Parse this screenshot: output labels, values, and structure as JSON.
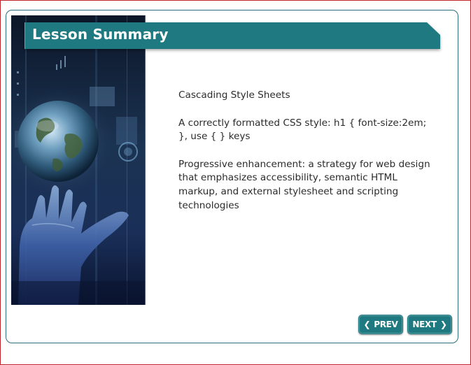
{
  "slide": {
    "title": "Lesson Summary",
    "paragraphs": [
      "Cascading Style Sheets",
      "A correctly formatted CSS style: h1 { font-size:2em; }, use { } keys",
      "Progressive enhancement: a strategy for web design that emphasizes accessibility, semantic HTML markup, and external stylesheet and scripting technologies"
    ]
  },
  "nav": {
    "prev_label": "PREV",
    "next_label": "NEXT",
    "prev_icon": "chevron-left-icon",
    "next_icon": "chevron-right-icon"
  },
  "colors": {
    "accent": "#1e7a80",
    "frame_border": "#2d6f7c",
    "outer_border": "#c0242c",
    "text": "#2b2b2b"
  }
}
